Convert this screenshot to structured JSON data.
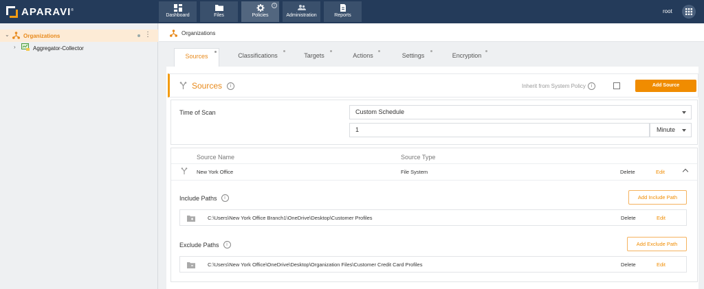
{
  "topbar": {
    "brand": "APARAVI",
    "brand_mark": "®",
    "nav": [
      {
        "label": "Dashboard",
        "icon": "dashboard-icon"
      },
      {
        "label": "Files",
        "icon": "folder-icon"
      },
      {
        "label": "Policies",
        "icon": "gear-icon",
        "active": true
      },
      {
        "label": "Administration",
        "icon": "users-icon"
      },
      {
        "label": "Reports",
        "icon": "report-icon"
      }
    ],
    "policies_info": "i",
    "user": "root"
  },
  "tree": {
    "root_label": "Organizations",
    "child_label": "Aggregator-Collector",
    "kebab": "⋮"
  },
  "breadcrumb": {
    "label": "Organizations"
  },
  "tabs": [
    {
      "label": "Sources",
      "active": true
    },
    {
      "label": "Classifications"
    },
    {
      "label": "Targets"
    },
    {
      "label": "Actions"
    },
    {
      "label": "Settings"
    },
    {
      "label": "Encryption"
    }
  ],
  "section": {
    "title": "Sources",
    "info": "i",
    "inherit_label": "Inherit from System Policy",
    "add_button": "Add Source"
  },
  "scan": {
    "label": "Time of Scan",
    "schedule_value": "Custom Schedule",
    "interval_value": "1",
    "unit_value": "Minute"
  },
  "sources_table": {
    "col_name": "Source Name",
    "col_type": "Source Type",
    "rows": [
      {
        "name": "New York Office",
        "type": "File System",
        "delete": "Delete",
        "edit": "Edit"
      }
    ]
  },
  "include": {
    "label": "Include Paths",
    "button": "Add Include Path",
    "paths": [
      {
        "path": "C:\\Users\\New York Office Branch1\\OneDrive\\Desktop\\Customer Profiles",
        "delete": "Delete",
        "edit": "Edit"
      }
    ]
  },
  "exclude": {
    "label": "Exclude Paths",
    "button": "Add Exclude Path",
    "paths": [
      {
        "path": "C:\\Users\\New York Office\\OneDrive\\Desktop\\Organization Files\\Customer Credit Card Profiles",
        "delete": "Delete",
        "edit": "Edit"
      }
    ]
  },
  "colors": {
    "topbar": "#243b5a",
    "accent": "#f08c00",
    "selected_row": "#fdebd6"
  }
}
